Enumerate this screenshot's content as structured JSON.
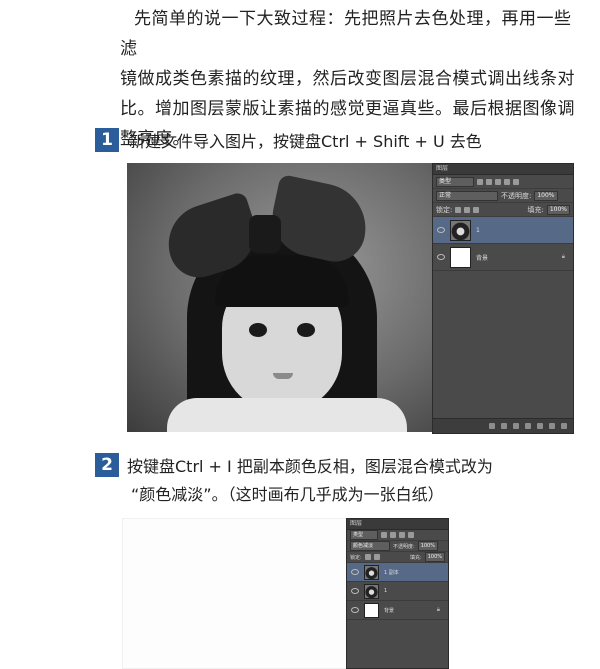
{
  "intro": {
    "line1": "先简单的说一下大致过程：先把照片去色处理，再用一些滤",
    "line2": "镜做成类色素描的纹理，然后改变图层混合模式调出线条对",
    "line3": "比。增加图层蒙版让素描的感觉更逼真些。最后根据图像调",
    "line4": "整亮度。"
  },
  "steps": [
    {
      "number": "1",
      "text": "新建文件导入图片，按键盘Ctrl + Shift + U 去色"
    },
    {
      "number": "2",
      "line1": "按键盘Ctrl + I 把副本颜色反相，图层混合模式改为",
      "line2": "“颜色减淡”。（这时画布几乎成为一张白纸）"
    }
  ],
  "panel1": {
    "tab": "图层",
    "kind": "类型",
    "blend": "正常",
    "opacity_label": "不透明度:",
    "opacity": "100%",
    "lock_label": "锁定:",
    "fill_label": "填充:",
    "fill": "100%",
    "layers": [
      {
        "name": "1",
        "selected": true
      },
      {
        "name": "背景",
        "selected": false
      }
    ]
  },
  "panel2": {
    "tab": "图层",
    "kind": "类型",
    "blend": "颜色减淡",
    "opacity_label": "不透明度:",
    "opacity": "100%",
    "lock_label": "锁定:",
    "fill_label": "填充:",
    "fill": "100%",
    "layers": [
      {
        "name": "1 副本",
        "selected": true
      },
      {
        "name": "1",
        "selected": false
      },
      {
        "name": "背景",
        "selected": false
      }
    ]
  },
  "colors": {
    "accent": "#2a5d9a",
    "panel": "#4a4a4a",
    "selected_layer": "#566a88"
  }
}
